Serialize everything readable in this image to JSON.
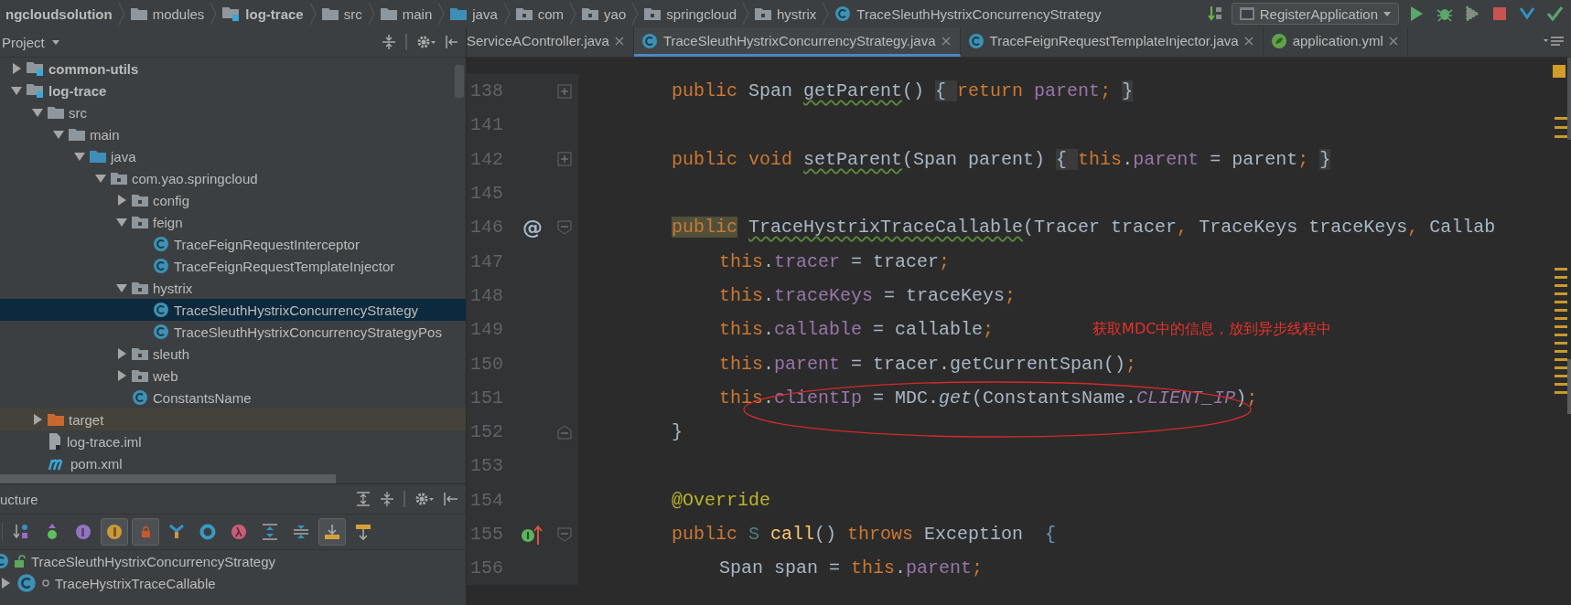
{
  "breadcrumbs": [
    {
      "label": "ngcloudsolution",
      "kind": "root"
    },
    {
      "label": "modules",
      "kind": "folder"
    },
    {
      "label": "log-trace",
      "kind": "module"
    },
    {
      "label": "src",
      "kind": "folder"
    },
    {
      "label": "main",
      "kind": "folder"
    },
    {
      "label": "java",
      "kind": "source"
    },
    {
      "label": "com",
      "kind": "package"
    },
    {
      "label": "yao",
      "kind": "package"
    },
    {
      "label": "springcloud",
      "kind": "package"
    },
    {
      "label": "hystrix",
      "kind": "package"
    },
    {
      "label": "TraceSleuthHystrixConcurrencyStrategy",
      "kind": "class"
    }
  ],
  "run_config": {
    "label": "RegisterApplication"
  },
  "project": {
    "title": "Project",
    "tree": [
      {
        "label": "common-utils",
        "kind": "module",
        "expanded": false,
        "selected": false
      },
      {
        "label": "log-trace",
        "kind": "module",
        "expanded": true,
        "selected": false,
        "children": [
          {
            "label": "src",
            "kind": "folder",
            "expanded": true,
            "selected": false,
            "children": [
              {
                "label": "main",
                "kind": "folder",
                "expanded": true,
                "selected": false,
                "children": [
                  {
                    "label": "java",
                    "kind": "source",
                    "expanded": true,
                    "selected": false,
                    "children": [
                      {
                        "label": "com.yao.springcloud",
                        "kind": "package",
                        "expanded": true,
                        "selected": false,
                        "children": [
                          {
                            "label": "config",
                            "kind": "package",
                            "expanded": false,
                            "selected": false
                          },
                          {
                            "label": "feign",
                            "kind": "package",
                            "expanded": true,
                            "selected": false,
                            "children": [
                              {
                                "label": "TraceFeignRequestInterceptor",
                                "kind": "class",
                                "selected": false
                              },
                              {
                                "label": "TraceFeignRequestTemplateInjector",
                                "kind": "class",
                                "selected": false
                              }
                            ]
                          },
                          {
                            "label": "hystrix",
                            "kind": "package",
                            "expanded": true,
                            "selected": false,
                            "children": [
                              {
                                "label": "TraceSleuthHystrixConcurrencyStrategy",
                                "kind": "class",
                                "selected": true
                              },
                              {
                                "label": "TraceSleuthHystrixConcurrencyStrategyPos",
                                "kind": "class",
                                "selected": false
                              }
                            ]
                          },
                          {
                            "label": "sleuth",
                            "kind": "package",
                            "expanded": false,
                            "selected": false
                          },
                          {
                            "label": "web",
                            "kind": "package",
                            "expanded": false,
                            "selected": false
                          },
                          {
                            "label": "ConstantsName",
                            "kind": "class",
                            "selected": false
                          }
                        ]
                      }
                    ]
                  }
                ]
              }
            ]
          },
          {
            "label": "target",
            "kind": "excluded",
            "expanded": false,
            "selected": false
          },
          {
            "label": "log-trace.iml",
            "kind": "iml",
            "selected": false
          },
          {
            "label": "pom.xml",
            "kind": "maven",
            "selected": false
          }
        ]
      }
    ]
  },
  "structure": {
    "title": "ucture",
    "toolbar": [
      {
        "kind": "sort",
        "pressed": false
      },
      {
        "kind": "inherited",
        "pressed": false
      },
      {
        "kind": "properties",
        "pressed": false
      },
      {
        "kind": "fields",
        "pressed": true
      },
      {
        "kind": "non-public",
        "pressed": true
      },
      {
        "kind": "anonymous",
        "pressed": false
      },
      {
        "kind": "ring",
        "pressed": false
      },
      {
        "kind": "lambda",
        "pressed": false
      },
      {
        "kind": "expand",
        "pressed": false
      },
      {
        "kind": "collapse",
        "pressed": false
      },
      {
        "kind": "autoscroll-to",
        "pressed": true
      },
      {
        "kind": "autoscroll-from",
        "pressed": false
      }
    ],
    "items": [
      {
        "label": "TraceSleuthHystrixConcurrencyStrategy",
        "kind": "class"
      },
      {
        "label": "TraceHystrixTraceCallable",
        "kind": "inner-class",
        "expanded": false
      }
    ]
  },
  "editor": {
    "tabs": [
      {
        "label": "ServiceAController.java",
        "kind": "plain",
        "selected": false
      },
      {
        "label": "TraceSleuthHystrixConcurrencyStrategy.java",
        "kind": "class",
        "selected": true
      },
      {
        "label": "TraceFeignRequestTemplateInjector.java",
        "kind": "class",
        "selected": false
      },
      {
        "label": "application.yml",
        "kind": "yaml",
        "selected": false
      }
    ],
    "lines": [
      {
        "number": "138",
        "fold": {
          "kind": "collapsed"
        },
        "tokens": [
          {
            "text": "public ",
            "kind": "kw"
          },
          {
            "text": "Span ",
            "kind": "plain"
          },
          {
            "text": "getParent",
            "kind": "warn"
          },
          {
            "text": "() ",
            "kind": "plain"
          },
          {
            "text": "{ ",
            "kind": "brace"
          },
          {
            "text": "return ",
            "kind": "kw"
          },
          {
            "text": "parent",
            "kind": "field"
          },
          {
            "text": "; ",
            "kind": "kw"
          },
          {
            "text": "}",
            "kind": "brace"
          }
        ]
      },
      {
        "number": "141"
      },
      {
        "number": "142",
        "fold": {
          "kind": "collapsed"
        },
        "tokens": [
          {
            "text": "public void ",
            "kind": "kw"
          },
          {
            "text": "setParent",
            "kind": "warn"
          },
          {
            "text": "(Span parent) ",
            "kind": "plain"
          },
          {
            "text": "{ ",
            "kind": "brace"
          },
          {
            "text": "this",
            "kind": "kw"
          },
          {
            "text": ".",
            "kind": "plain"
          },
          {
            "text": "parent",
            "kind": "field"
          },
          {
            "text": " = parent",
            "kind": "plain"
          },
          {
            "text": "; ",
            "kind": "kw"
          },
          {
            "text": "}",
            "kind": "brace"
          }
        ]
      },
      {
        "number": "145"
      },
      {
        "number": "146",
        "fold": {
          "kind": "start"
        },
        "gutter_text": "@",
        "tokens": [
          {
            "text": "public",
            "kind": "kw-highlight"
          },
          {
            "text": "TraceHystrixTraceCallable",
            "kind": "warn"
          },
          {
            "text": "(Tracer tracer",
            "kind": "plain"
          },
          {
            "text": ", ",
            "kind": "kw"
          },
          {
            "text": "TraceKeys traceKeys",
            "kind": "plain"
          },
          {
            "text": ", ",
            "kind": "kw"
          },
          {
            "text": "Callab",
            "kind": "plain"
          }
        ]
      },
      {
        "number": "147",
        "body": true,
        "tokens": [
          {
            "text": "this",
            "kind": "kw"
          },
          {
            "text": ".",
            "kind": "plain"
          },
          {
            "text": "tracer",
            "kind": "field"
          },
          {
            "text": " = tracer",
            "kind": "plain"
          },
          {
            "text": ";",
            "kind": "kw"
          }
        ]
      },
      {
        "number": "148",
        "body": true,
        "tokens": [
          {
            "text": "this",
            "kind": "kw"
          },
          {
            "text": ".",
            "kind": "plain"
          },
          {
            "text": "traceKeys",
            "kind": "field"
          },
          {
            "text": " = traceKeys",
            "kind": "plain"
          },
          {
            "text": ";",
            "kind": "kw"
          }
        ]
      },
      {
        "number": "149",
        "body": true,
        "tokens": [
          {
            "text": "this",
            "kind": "kw"
          },
          {
            "text": ".",
            "kind": "plain"
          },
          {
            "text": "callable",
            "kind": "field"
          },
          {
            "text": " = callable",
            "kind": "plain"
          },
          {
            "text": ";",
            "kind": "kw"
          },
          {
            "text": "获取MDC中的信息，放到异步线程中",
            "kind": "note"
          }
        ]
      },
      {
        "number": "150",
        "body": true,
        "tokens": [
          {
            "text": "this",
            "kind": "kw"
          },
          {
            "text": ".",
            "kind": "plain"
          },
          {
            "text": "parent",
            "kind": "field"
          },
          {
            "text": " = tracer.getCurrentSpan()",
            "kind": "plain"
          },
          {
            "text": ";",
            "kind": "kw"
          }
        ]
      },
      {
        "number": "151",
        "body": true,
        "tokens": [
          {
            "text": "this",
            "kind": "kw"
          },
          {
            "text": ".",
            "kind": "plain"
          },
          {
            "text": "clientIp",
            "kind": "field"
          },
          {
            "text": " = MDC.",
            "kind": "plain"
          },
          {
            "text": "get",
            "kind": "italic"
          },
          {
            "text": "(ConstantsName.",
            "kind": "plain"
          },
          {
            "text": "CLIENT_IP",
            "kind": "static"
          },
          {
            "text": ")",
            "kind": "plain"
          },
          {
            "text": ";",
            "kind": "kw"
          }
        ]
      },
      {
        "number": "152",
        "fold": {
          "kind": "end"
        },
        "tokens": [
          {
            "text": "}",
            "kind": "plain"
          }
        ]
      },
      {
        "number": "153"
      },
      {
        "number": "154",
        "tokens": [
          {
            "text": "@Override",
            "kind": "annotation"
          }
        ]
      },
      {
        "number": "155",
        "fold": {
          "kind": "start"
        },
        "gutter_icon": {
          "kind": "implements"
        },
        "tokens": [
          {
            "text": "public ",
            "kind": "kw"
          },
          {
            "text": "S ",
            "kind": "typeparam"
          },
          {
            "text": "call",
            "kind": "decl"
          },
          {
            "text": "() ",
            "kind": "plain"
          },
          {
            "text": "throws ",
            "kind": "kw"
          },
          {
            "text": "Exception  ",
            "kind": "plain"
          },
          {
            "text": "{",
            "kind": "match"
          }
        ]
      },
      {
        "number": "156",
        "body": true,
        "tokens": [
          {
            "text": "Span span = ",
            "kind": "plain"
          },
          {
            "text": "this",
            "kind": "kw"
          },
          {
            "text": ".",
            "kind": "plain"
          },
          {
            "text": "parent",
            "kind": "field"
          },
          {
            "text": ";",
            "kind": "kw"
          }
        ]
      }
    ]
  }
}
